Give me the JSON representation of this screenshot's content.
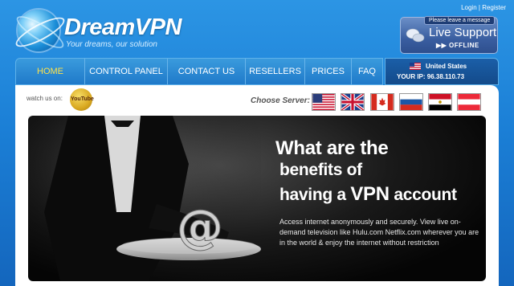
{
  "brand": {
    "name": "DreamVPN",
    "tagline": "Your dreams, our solution"
  },
  "top_links": {
    "login": "Login",
    "separator": "|",
    "register": "Register"
  },
  "live_support": {
    "tab_label": "Please leave a message",
    "label": "Live Support",
    "status": "OFFLINE",
    "status_arrows": "▶▶"
  },
  "nav": {
    "items": [
      {
        "label": "HOME",
        "active": true
      },
      {
        "label": "CONTROL PANEL",
        "active": false
      },
      {
        "label": "CONTACT US",
        "active": false
      },
      {
        "label": "RESELLERS",
        "active": false
      },
      {
        "label": "PRICES",
        "active": false
      },
      {
        "label": "FAQ",
        "active": false
      }
    ]
  },
  "server": {
    "country": "United States",
    "ip_text": "YOUR IP: 96.38.110.73"
  },
  "content": {
    "watch_label": "watch us on:",
    "youtube_text": "YouTube",
    "choose_server_label": "Choose Server:",
    "server_flags": [
      "us-flag-icon",
      "uk-flag-icon",
      "canada-flag-icon",
      "russia-flag-icon",
      "egypt-flag-icon",
      "austria-flag-icon"
    ]
  },
  "banner": {
    "headline_1": "What are the",
    "headline_2": "benefits of",
    "headline_3_pre": "having a ",
    "headline_3_vpn": "VPN",
    "headline_3_post": " account",
    "body": "Access internet anonymously and securely. View live on-demand television like Hulu.com Netflix.com wherever you are in the world & enjoy the internet without restriction"
  },
  "colors": {
    "background": "#1b7fd6",
    "nav_active": "#ffe24a",
    "panel": "#ffffff"
  }
}
